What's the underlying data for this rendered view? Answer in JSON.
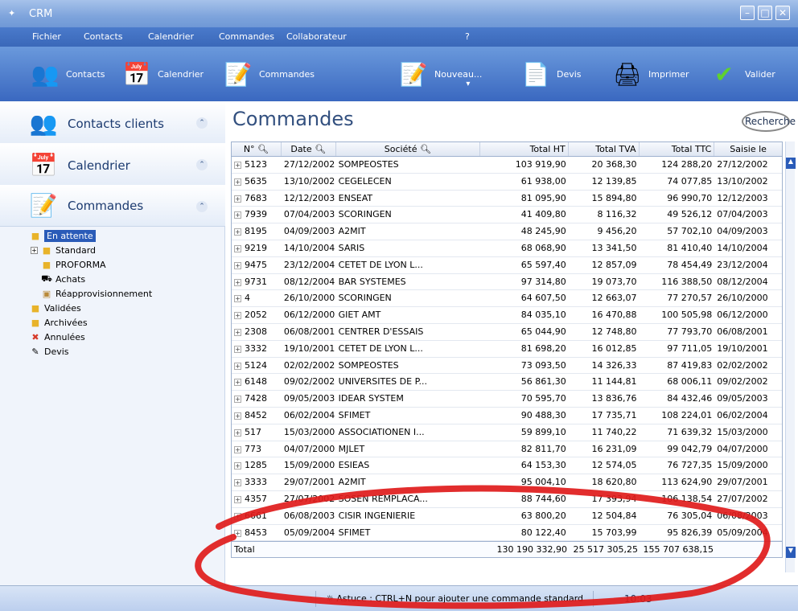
{
  "window": {
    "app_title": "CRM",
    "logo_icon": "crm-logo-icon"
  },
  "menu": [
    "Fichier",
    "Contacts",
    "Calendrier",
    "Commandes",
    "Collaborateur",
    "?"
  ],
  "toolbar": {
    "contacts": "Contacts",
    "calendrier": "Calendrier",
    "commandes": "Commandes",
    "nouveau": "Nouveau...",
    "devis": "Devis",
    "imprimer": "Imprimer",
    "valider": "Valider"
  },
  "sidebar": {
    "sections": [
      "Contacts clients",
      "Calendrier",
      "Commandes"
    ],
    "tree": {
      "en_attente": "En attente",
      "standard": "Standard",
      "proforma": "PROFORMA",
      "achats": "Achats",
      "reappro": "Réapprovisionnement",
      "validees": "Validées",
      "archivees": "Archivées",
      "annulees": "Annulées",
      "devis": "Devis"
    }
  },
  "main": {
    "title": "Commandes",
    "search_label": "Recherche"
  },
  "grid": {
    "columns": [
      "N°",
      "Date",
      "Société",
      "Total HT",
      "Total TVA",
      "Total TTC",
      "Saisie le"
    ],
    "rows": [
      [
        "5123",
        "27/12/2002",
        "SOMPEOSTES",
        "103 919,90",
        "20 368,30",
        "124 288,20",
        "27/12/2002"
      ],
      [
        "5635",
        "13/10/2002",
        "CEGELECEN",
        "61 938,00",
        "12 139,85",
        "74 077,85",
        "13/10/2002"
      ],
      [
        "7683",
        "12/12/2003",
        "ENSEAT",
        "81 095,90",
        "15 894,80",
        "96 990,70",
        "12/12/2003"
      ],
      [
        "7939",
        "07/04/2003",
        "SCORINGEN",
        "41 409,80",
        "8 116,32",
        "49 526,12",
        "07/04/2003"
      ],
      [
        "8195",
        "04/09/2003",
        "A2MIT",
        "48 245,90",
        "9 456,20",
        "57 702,10",
        "04/09/2003"
      ],
      [
        "9219",
        "14/10/2004",
        "SARIS",
        "68 068,90",
        "13 341,50",
        "81 410,40",
        "14/10/2004"
      ],
      [
        "9475",
        "23/12/2004",
        "CETET DE LYON L...",
        "65 597,40",
        "12 857,09",
        "78 454,49",
        "23/12/2004"
      ],
      [
        "9731",
        "08/12/2004",
        "BAR SYSTEMES",
        "97 314,80",
        "19 073,70",
        "116 388,50",
        "08/12/2004"
      ],
      [
        "4",
        "26/10/2000",
        "SCORINGEN",
        "64 607,50",
        "12 663,07",
        "77 270,57",
        "26/10/2000"
      ],
      [
        "2052",
        "06/12/2000",
        "GIET AMT",
        "84 035,10",
        "16 470,88",
        "100 505,98",
        "06/12/2000"
      ],
      [
        "2308",
        "06/08/2001",
        "CENTRER D'ESSAIS",
        "65 044,90",
        "12 748,80",
        "77 793,70",
        "06/08/2001"
      ],
      [
        "3332",
        "19/10/2001",
        "CETET DE LYON L...",
        "81 698,20",
        "16 012,85",
        "97 711,05",
        "19/10/2001"
      ],
      [
        "5124",
        "02/02/2002",
        "SOMPEOSTES",
        "73 093,50",
        "14 326,33",
        "87 419,83",
        "02/02/2002"
      ],
      [
        "6148",
        "09/02/2002",
        "UNIVERSITES DE P...",
        "56 861,30",
        "11 144,81",
        "68 006,11",
        "09/02/2002"
      ],
      [
        "7428",
        "09/05/2003",
        "IDEAR SYSTEM",
        "70 595,70",
        "13 836,76",
        "84 432,46",
        "09/05/2003"
      ],
      [
        "8452",
        "06/02/2004",
        "SFIMET",
        "90 488,30",
        "17 735,71",
        "108 224,01",
        "06/02/2004"
      ],
      [
        "517",
        "15/03/2000",
        "ASSOCIATIONEN I...",
        "59 899,10",
        "11 740,22",
        "71 639,32",
        "15/03/2000"
      ],
      [
        "773",
        "04/07/2000",
        "MJLET",
        "82 811,70",
        "16 231,09",
        "99 042,79",
        "04/07/2000"
      ],
      [
        "1285",
        "15/09/2000",
        "ESIEAS",
        "64 153,30",
        "12 574,05",
        "76 727,35",
        "15/09/2000"
      ],
      [
        "3333",
        "29/07/2001",
        "A2MIT",
        "95 004,10",
        "18 620,80",
        "113 624,90",
        "29/07/2001"
      ],
      [
        "4357",
        "27/07/2002",
        "SOSEN REMPLACA...",
        "88 744,60",
        "17 393,94",
        "106 138,54",
        "27/07/2002"
      ],
      [
        "6661",
        "06/08/2003",
        "CISIR INGENIERIE",
        "63 800,20",
        "12 504,84",
        "76 305,04",
        "06/08/2003"
      ],
      [
        "8453",
        "05/09/2004",
        "SFIMET",
        "80 122,40",
        "15 703,99",
        "95 826,39",
        "05/09/2004"
      ]
    ],
    "total": {
      "label": "Total",
      "ht": "130 190 332,90",
      "tva": "25 517 305,25",
      "ttc": "155 707 638,15"
    }
  },
  "status": {
    "tip": "Astuce : CTRL+N pour ajouter une commande standard",
    "clock": "10:03"
  },
  "colors": {
    "accent": "#2a5bb8",
    "annotation": "#e01b1b"
  }
}
